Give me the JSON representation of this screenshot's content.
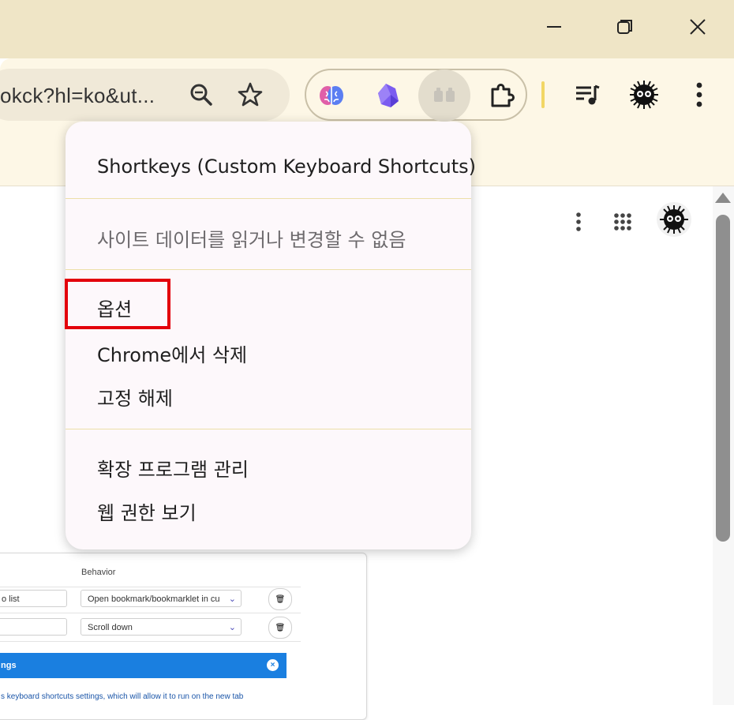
{
  "window": {
    "minimize_icon": "minimize-icon",
    "restore_icon": "restore-icon",
    "close_icon": "close-icon"
  },
  "omnibox": {
    "url_text": "okck?hl=ko&ut...",
    "zoom_icon": "zoom-out-icon",
    "star_icon": "bookmark-star-icon"
  },
  "extensions_pinned": [
    {
      "name": "brain-extension-icon"
    },
    {
      "name": "crystal-extension-icon"
    },
    {
      "name": "shortkeys-extension-icon",
      "active": true
    },
    {
      "name": "extensions-puzzle-icon"
    }
  ],
  "toolbar_right": [
    "reading-list-icon",
    "profile-avatar-icon",
    "more-menu-icon"
  ],
  "page_icons": [
    "more-vert-icon",
    "apps-grid-icon",
    "account-avatar-icon"
  ],
  "context_menu": {
    "extension_name": "Shortkeys (Custom Keyboard Shortcuts)",
    "site_access": "사이트 데이터를 읽거나 변경할 수 없음",
    "options": "옵션",
    "remove": "Chrome에서 삭제",
    "unpin": "고정 해제",
    "manage": "확장 프로그램 관리",
    "web_permissions": "웹 권한 보기"
  },
  "background_screenshot": {
    "column_header": "Behavior",
    "rows": [
      {
        "input": "o list",
        "select": "Open bookmark/bookmarklet in cu"
      },
      {
        "input": "",
        "select": "Scroll down"
      }
    ],
    "banner_title": "ngs",
    "banner_close": "×",
    "banner_text": "s keyboard shortcuts settings, which will allow it to run on the new tab"
  },
  "colors": {
    "titlebar": "#efe5c6",
    "toolbar": "#fdf7e6",
    "menu_bg": "#fdf8fb",
    "highlight_box": "#e3000b",
    "banner": "#1a7fe0"
  }
}
